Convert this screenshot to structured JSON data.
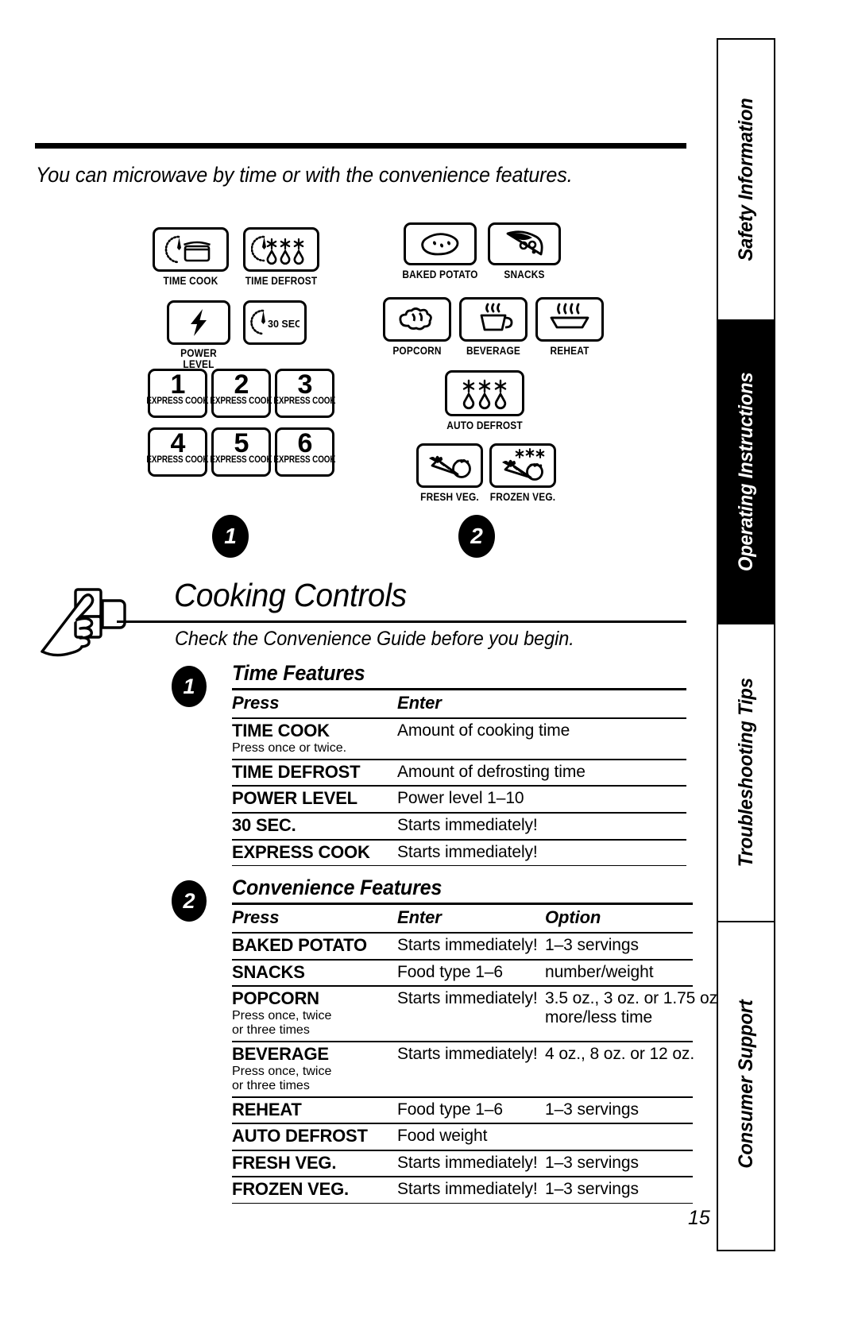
{
  "page": {
    "number": "15",
    "intro": "You can microwave by time or with the convenience features."
  },
  "control_panel": {
    "group1_marker": "1",
    "group2_marker": "2",
    "group1_buttons": [
      {
        "label": "TIME COOK",
        "icon": "clock-food-container-icon"
      },
      {
        "label": "TIME DEFROST",
        "icon": "clock-snowflake-drop-icon"
      },
      {
        "label": "POWER LEVEL",
        "icon": "lightning-bolt-icon"
      },
      {
        "label": "30 SEC.",
        "icon": "clock-30-sec-icon"
      }
    ],
    "express_cook_buttons": [
      {
        "digit": "1",
        "label": "EXPRESS COOK"
      },
      {
        "digit": "2",
        "label": "EXPRESS COOK"
      },
      {
        "digit": "3",
        "label": "EXPRESS COOK"
      },
      {
        "digit": "4",
        "label": "EXPRESS COOK"
      },
      {
        "digit": "5",
        "label": "EXPRESS COOK"
      },
      {
        "digit": "6",
        "label": "EXPRESS COOK"
      }
    ],
    "group2_buttons": [
      {
        "label": "BAKED POTATO",
        "icon": "potato-icon"
      },
      {
        "label": "SNACKS",
        "icon": "pizza-slice-icon"
      },
      {
        "label": "POPCORN",
        "icon": "popcorn-icon"
      },
      {
        "label": "BEVERAGE",
        "icon": "steaming-cup-icon"
      },
      {
        "label": "REHEAT",
        "icon": "steaming-dish-icon"
      },
      {
        "label": "AUTO DEFROST",
        "icon": "snowflake-drop-icon"
      },
      {
        "label": "FRESH VEG.",
        "icon": "carrot-tomato-icon"
      },
      {
        "label": "FROZEN VEG.",
        "icon": "frozen-carrot-tomato-icon"
      }
    ]
  },
  "section": {
    "title": "Cooking Controls",
    "subtitle": "Check the Convenience Guide before you begin."
  },
  "time_features": {
    "marker": "1",
    "title": "Time Features",
    "headers": [
      "Press",
      "Enter"
    ],
    "rows": [
      {
        "press": "TIME COOK",
        "press_note": "Press once or twice.",
        "enter": "Amount of cooking time"
      },
      {
        "press": "TIME DEFROST",
        "press_note": "",
        "enter": "Amount of defrosting time"
      },
      {
        "press": "POWER LEVEL",
        "press_note": "",
        "enter": "Power level 1–10"
      },
      {
        "press": "30 SEC.",
        "press_note": "",
        "enter": "Starts immediately!"
      },
      {
        "press": "EXPRESS COOK",
        "press_note": "",
        "enter": "Starts immediately!"
      }
    ]
  },
  "convenience_features": {
    "marker": "2",
    "title": "Convenience Features",
    "headers": [
      "Press",
      "Enter",
      "Option"
    ],
    "rows": [
      {
        "press": "BAKED POTATO",
        "press_note": "",
        "enter": "Starts immediately!",
        "option": "1–3 servings",
        "option_note": ""
      },
      {
        "press": "SNACKS",
        "press_note": "",
        "enter": "Food type 1–6",
        "option": "number/weight",
        "option_note": ""
      },
      {
        "press": "POPCORN",
        "press_note": "Press once, twice\nor three times",
        "enter": "Starts immediately!",
        "option": "3.5 oz., 3 oz. or 1.75 oz.",
        "option_note": "more/less time"
      },
      {
        "press": "BEVERAGE",
        "press_note": "Press once, twice\nor three times",
        "enter": "Starts immediately!",
        "option": "4 oz., 8 oz. or 12 oz.",
        "option_note": ""
      },
      {
        "press": "REHEAT",
        "press_note": "",
        "enter": "Food type 1–6",
        "option": "1–3 servings",
        "option_note": ""
      },
      {
        "press": "AUTO DEFROST",
        "press_note": "",
        "enter": "Food weight",
        "option": "",
        "option_note": ""
      },
      {
        "press": "FRESH VEG.",
        "press_note": "",
        "enter": "Starts immediately!",
        "option": "1–3 servings",
        "option_note": ""
      },
      {
        "press": "FROZEN VEG.",
        "press_note": "",
        "enter": "Starts immediately!",
        "option": "1–3 servings",
        "option_note": ""
      }
    ]
  },
  "sidebar": {
    "tabs": [
      {
        "label": "Safety Information",
        "active": false
      },
      {
        "label": "Operating Instructions",
        "active": true
      },
      {
        "label": "Troubleshooting Tips",
        "active": false
      },
      {
        "label": "Consumer Support",
        "active": false
      }
    ]
  }
}
